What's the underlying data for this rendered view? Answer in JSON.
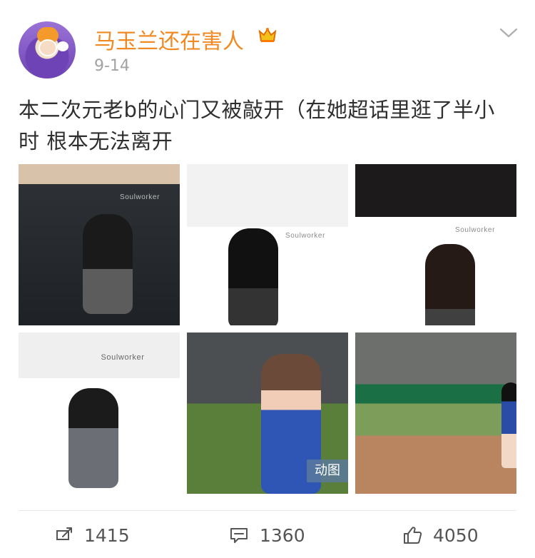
{
  "author": {
    "name": "马玉兰还在害人",
    "time": "9-14"
  },
  "post": {
    "text": "本二次元老b的心门又被敲开（在她超话里逛了半小时 根本无法离开"
  },
  "media": {
    "images": [
      {
        "brand": "Soulworker"
      },
      {
        "brand": "Soulworker"
      },
      {
        "brand": "Soulworker"
      },
      {
        "brand": "Soulworker"
      },
      {
        "brand": ""
      },
      {
        "brand": ""
      }
    ],
    "badge": "动图"
  },
  "actions": {
    "repost": "1415",
    "comment": "1360",
    "like": "4050"
  },
  "colors": {
    "name": "#f08a24",
    "time": "#a3a3a3",
    "badge": "#5a7a9c"
  },
  "icons": {
    "chevron": "chevron-down-icon",
    "crown": "crown-icon",
    "repost": "repost-icon",
    "comment": "comment-icon",
    "like": "thumbs-up-icon"
  }
}
